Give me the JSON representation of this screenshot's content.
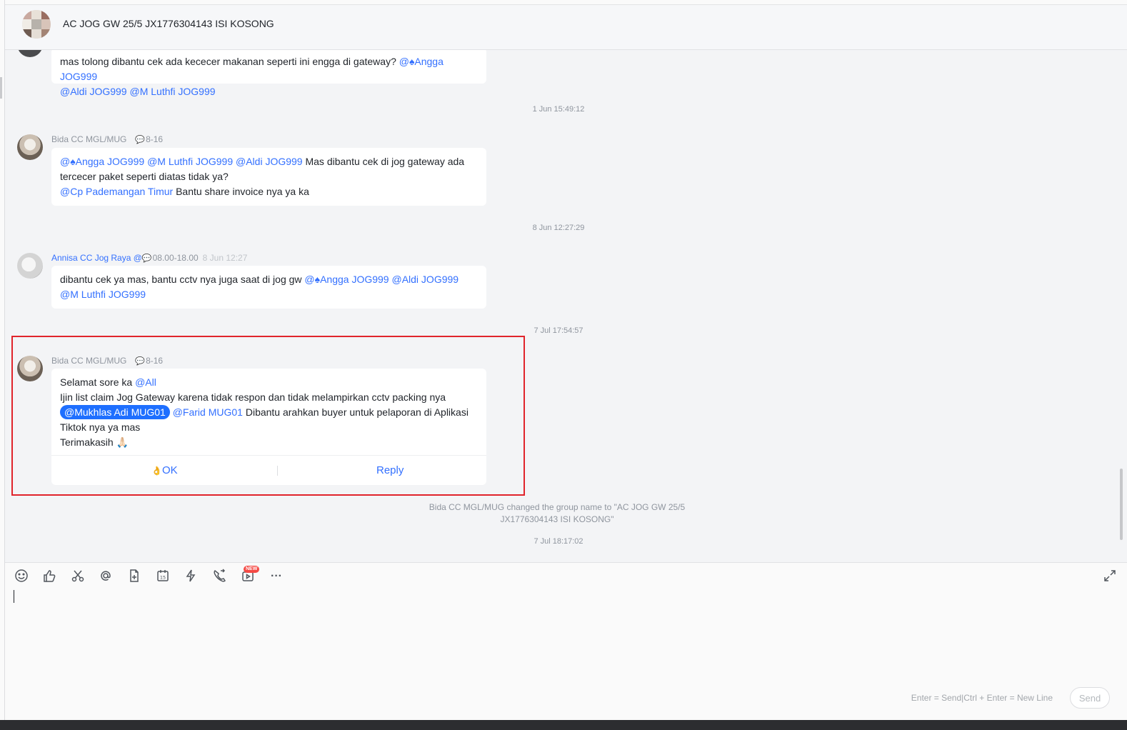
{
  "header": {
    "title": "AC JOG GW 25/5 JX1776304143 ISI KOSONG"
  },
  "messages": [
    {
      "text_a": "mas tolong dibantu cek ada kececer makanan seperti ini engga di gateway? ",
      "mention_a": "@♠Angga JOG999",
      "mention_b": "@Aldi JOG999",
      "mention_c": "@M Luthfi JOG999"
    },
    {
      "sender": "Bida CC MGL/MUG",
      "schedule": "8-16",
      "mention_a": "@♠Angga JOG999",
      "mention_b": "@M Luthfi JOG999",
      "mention_c": "@Aldi JOG999",
      "text_a": " Mas dibantu cek di jog gateway ada tercecer paket seperti diatas tidak ya?",
      "mention_d": "@Cp Pademangan Timur",
      "text_b": " Bantu share invoice nya ya ka"
    },
    {
      "sender": "Annisa CC Jog Raya @",
      "schedule": "08.00-18.00",
      "sent_at": "8 Jun 12:27",
      "text_a": "dibantu cek ya mas, bantu cctv nya juga saat di jog gw ",
      "mention_a": "@♠Angga JOG999",
      "mention_b": "@Aldi JOG999",
      "mention_c": "@M Luthfi JOG999"
    },
    {
      "sender": "Bida CC MGL/MUG",
      "schedule": "8-16",
      "line1": "Selamat sore ka ",
      "mention_all": "@All",
      "line2": "Ijin list claim Jog Gateway karena tidak respon dan tidak melampirkan cctv packing nya",
      "mention_pill": "@Mukhlas Adi MUG01",
      "mention_farid": "@Farid MUG01",
      "line3": " Dibantu arahkan buyer untuk pelaporan di Aplikasi Tiktok nya ya mas",
      "line4": "Terimakasih ",
      "emoji": "🙏🏻",
      "ok_emoji": "👌",
      "ok_label": "OK",
      "reply_label": "Reply"
    }
  ],
  "timestamps": {
    "t1": "1 Jun 15:49:12",
    "t2": "8 Jun 12:27:29",
    "t3": "7 Jul 17:54:57",
    "t4": "7 Jul 18:17:02"
  },
  "system": {
    "rename_line1": "Bida CC MGL/MUG changed the group name to \"AC JOG GW 25/5",
    "rename_line2": "JX1776304143 ISI KOSONG\""
  },
  "toolbar": {
    "icons": [
      "emoji-icon",
      "thumbs-up-icon",
      "scissors-icon",
      "at-icon",
      "doc-add-icon",
      "calendar-icon",
      "lightning-icon",
      "video-call-icon",
      "live-icon",
      "more-icon"
    ],
    "calendar_day": "15",
    "new_badge": "NEW",
    "more": "···"
  },
  "composer": {
    "hint": "Enter = Send|Ctrl + Enter = New Line",
    "send_label": "Send"
  },
  "colors": {
    "accent": "#3370ff",
    "highlight_border": "#e0242b",
    "pill": "#1e6fff"
  }
}
